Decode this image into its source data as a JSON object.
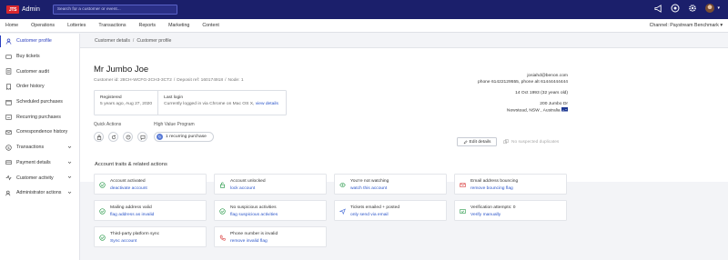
{
  "header": {
    "logo_text": "JTS",
    "app_title": "Admin",
    "search_placeholder": "Search for a customer or event...",
    "icons": [
      "megaphone-icon",
      "help-icon",
      "settings-icon"
    ]
  },
  "nav": {
    "items": [
      "Home",
      "Operations",
      "Lotteries",
      "Transactions",
      "Reports",
      "Marketing",
      "Content"
    ],
    "channel": "Channel: Paystream Benchmark"
  },
  "sidebar": {
    "items": [
      {
        "label": "Customer profile",
        "icon": "user-icon",
        "active": true
      },
      {
        "label": "Buy tickets",
        "icon": "ticket-icon"
      },
      {
        "label": "Customer audit",
        "icon": "list-icon"
      },
      {
        "label": "Order history",
        "icon": "receipt-icon"
      },
      {
        "label": "Scheduled purchases",
        "icon": "calendar-icon"
      },
      {
        "label": "Recurring purchases",
        "icon": "repeat-icon"
      },
      {
        "label": "Correspondence history",
        "icon": "mail-icon"
      },
      {
        "label": "Transactions",
        "icon": "dollar-icon",
        "expandable": true
      },
      {
        "label": "Payment details",
        "icon": "card-icon",
        "expandable": true
      },
      {
        "label": "Customer activity",
        "icon": "activity-icon",
        "expandable": true
      },
      {
        "label": "Administrator actions",
        "icon": "admin-icon",
        "expandable": true
      }
    ]
  },
  "breadcrumb": [
    "Customer details",
    "Customer profile"
  ],
  "profile": {
    "name": "Mr Jumbo Joe",
    "customer_id": "Customer id: 28CH-WCFG-2CH3-3CT2",
    "deposit_ref": "Deposit ref: 160174918",
    "node": "Node: 1",
    "registered_label": "Registered",
    "registered_value": "5 years ago, Aug 27, 2020",
    "last_login_label": "Last login",
    "last_login_value": "Currently logged in via Chrome on Mac OS X,",
    "last_login_link": "view details",
    "quick_actions_label": "Quick Actions",
    "high_value_label": "High Value Program",
    "high_value_pill": "1 recurring purchase",
    "email": "josiahd@benon.com",
    "phones": "phone 61422129555, phone alt 61444444444",
    "dob": "14 Oct 1993 (32 years old)",
    "address_line1": "200 Jumbo Dr",
    "address_line2": "Newstead, NSW , Australia",
    "edit_label": "Edit details",
    "duplicates": "No suspected duplicates"
  },
  "traits": {
    "title": "Account traits & related actions",
    "cards": [
      {
        "title": "Account activated",
        "action": "deactivate account",
        "icon": "check-circle-icon",
        "color": "#2e9c4e"
      },
      {
        "title": "Account unlocked",
        "action": "lock account",
        "icon": "unlock-icon",
        "color": "#2e9c4e"
      },
      {
        "title": "You're not watching",
        "action": "watch this account",
        "icon": "eye-icon",
        "color": "#2e9c4e"
      },
      {
        "title": "Email address bouncing",
        "action": "remove bouncing flag",
        "icon": "mail-alert-icon",
        "color": "#d83a3a"
      },
      {
        "title": "Mailing address valid",
        "action": "flag address as invalid",
        "icon": "check-circle-icon",
        "color": "#2e9c4e"
      },
      {
        "title": "No suspicious activities",
        "action": "flag suspicious activities",
        "icon": "check-circle-icon",
        "color": "#2e9c4e"
      },
      {
        "title": "Tickets emailed + posted",
        "action": "only send via email",
        "icon": "send-icon",
        "color": "#4a6fd8"
      },
      {
        "title": "Verification attempts: 0",
        "action": "Verify manually",
        "icon": "verify-icon",
        "color": "#2e9c4e"
      },
      {
        "title": "Third-party platform sync",
        "action": "Sync account",
        "icon": "check-circle-icon",
        "color": "#2e9c4e"
      },
      {
        "title": "Phone number is invalid",
        "action": "remove invalid flag",
        "icon": "phone-icon",
        "color": "#d83a3a"
      }
    ]
  }
}
